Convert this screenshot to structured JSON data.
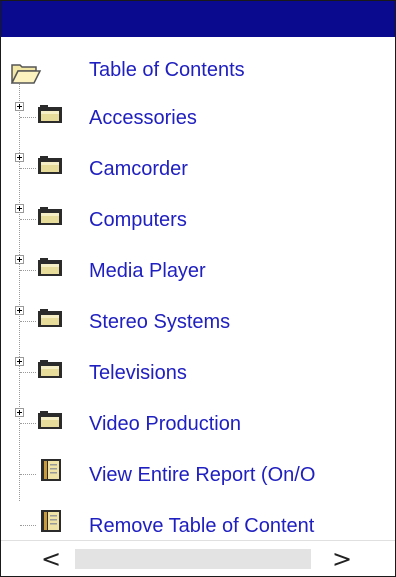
{
  "tree": {
    "root": {
      "label": "Table of Contents",
      "icon": "open-folder-icon"
    },
    "items": [
      {
        "label": "Accessories",
        "icon": "folder-icon",
        "expandable": true
      },
      {
        "label": "Camcorder",
        "icon": "folder-icon",
        "expandable": true
      },
      {
        "label": "Computers",
        "icon": "folder-icon",
        "expandable": true
      },
      {
        "label": "Media Player",
        "icon": "folder-icon",
        "expandable": true
      },
      {
        "label": "Stereo Systems",
        "icon": "folder-icon",
        "expandable": true
      },
      {
        "label": "Televisions",
        "icon": "folder-icon",
        "expandable": true
      },
      {
        "label": "Video Production",
        "icon": "folder-icon",
        "expandable": true
      },
      {
        "label": "View Entire Report (On/O",
        "icon": "report-page-icon",
        "expandable": false
      },
      {
        "label": "Remove Table of Content",
        "icon": "report-page-icon",
        "expandable": false
      }
    ]
  },
  "scrollbar": {
    "left_arrow": "<",
    "right_arrow": ">"
  },
  "colors": {
    "titlebar": "#0a0a8f",
    "link": "#2020c0",
    "border": "#1a1a1a"
  }
}
